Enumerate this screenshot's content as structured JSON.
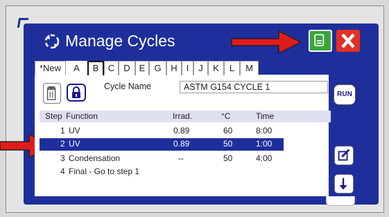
{
  "dialog": {
    "title": "Manage Cycles",
    "save_icon": "save-icon",
    "close_icon": "close-icon",
    "cycle_icon": "refresh-cycle-icon"
  },
  "tabs": [
    "*New",
    "A",
    "B",
    "C",
    "D",
    "E",
    "G",
    "H",
    "I",
    "J",
    "K",
    "L",
    "M"
  ],
  "selected_tab": "B",
  "cycle_name": {
    "label": "Cycle Name",
    "value": "ASTM G154 CYCLE 1"
  },
  "table": {
    "headers": {
      "step": "Step",
      "function": "Function",
      "irrad": "Irrad.",
      "temp": "°C",
      "time": "Time"
    },
    "rows": [
      {
        "step": "1",
        "function": "UV",
        "irrad": "0.89",
        "temp": "60",
        "time": "8:00"
      },
      {
        "step": "2",
        "function": "UV",
        "irrad": "0.89",
        "temp": "50",
        "time": "1:00"
      },
      {
        "step": "3",
        "function": "Condensation",
        "irrad": "--",
        "temp": "50",
        "time": "4:00"
      },
      {
        "step": "4",
        "function": "Final - Go to step 1",
        "irrad": "",
        "temp": "",
        "time": ""
      }
    ],
    "selected_row": 2
  },
  "buttons": {
    "run": "RUN"
  },
  "colors": {
    "dialog_blue": "#1e2f9c",
    "save_green": "#3aa63a",
    "close_red": "#e43125",
    "annotation_arrow": "#e11b1b"
  }
}
